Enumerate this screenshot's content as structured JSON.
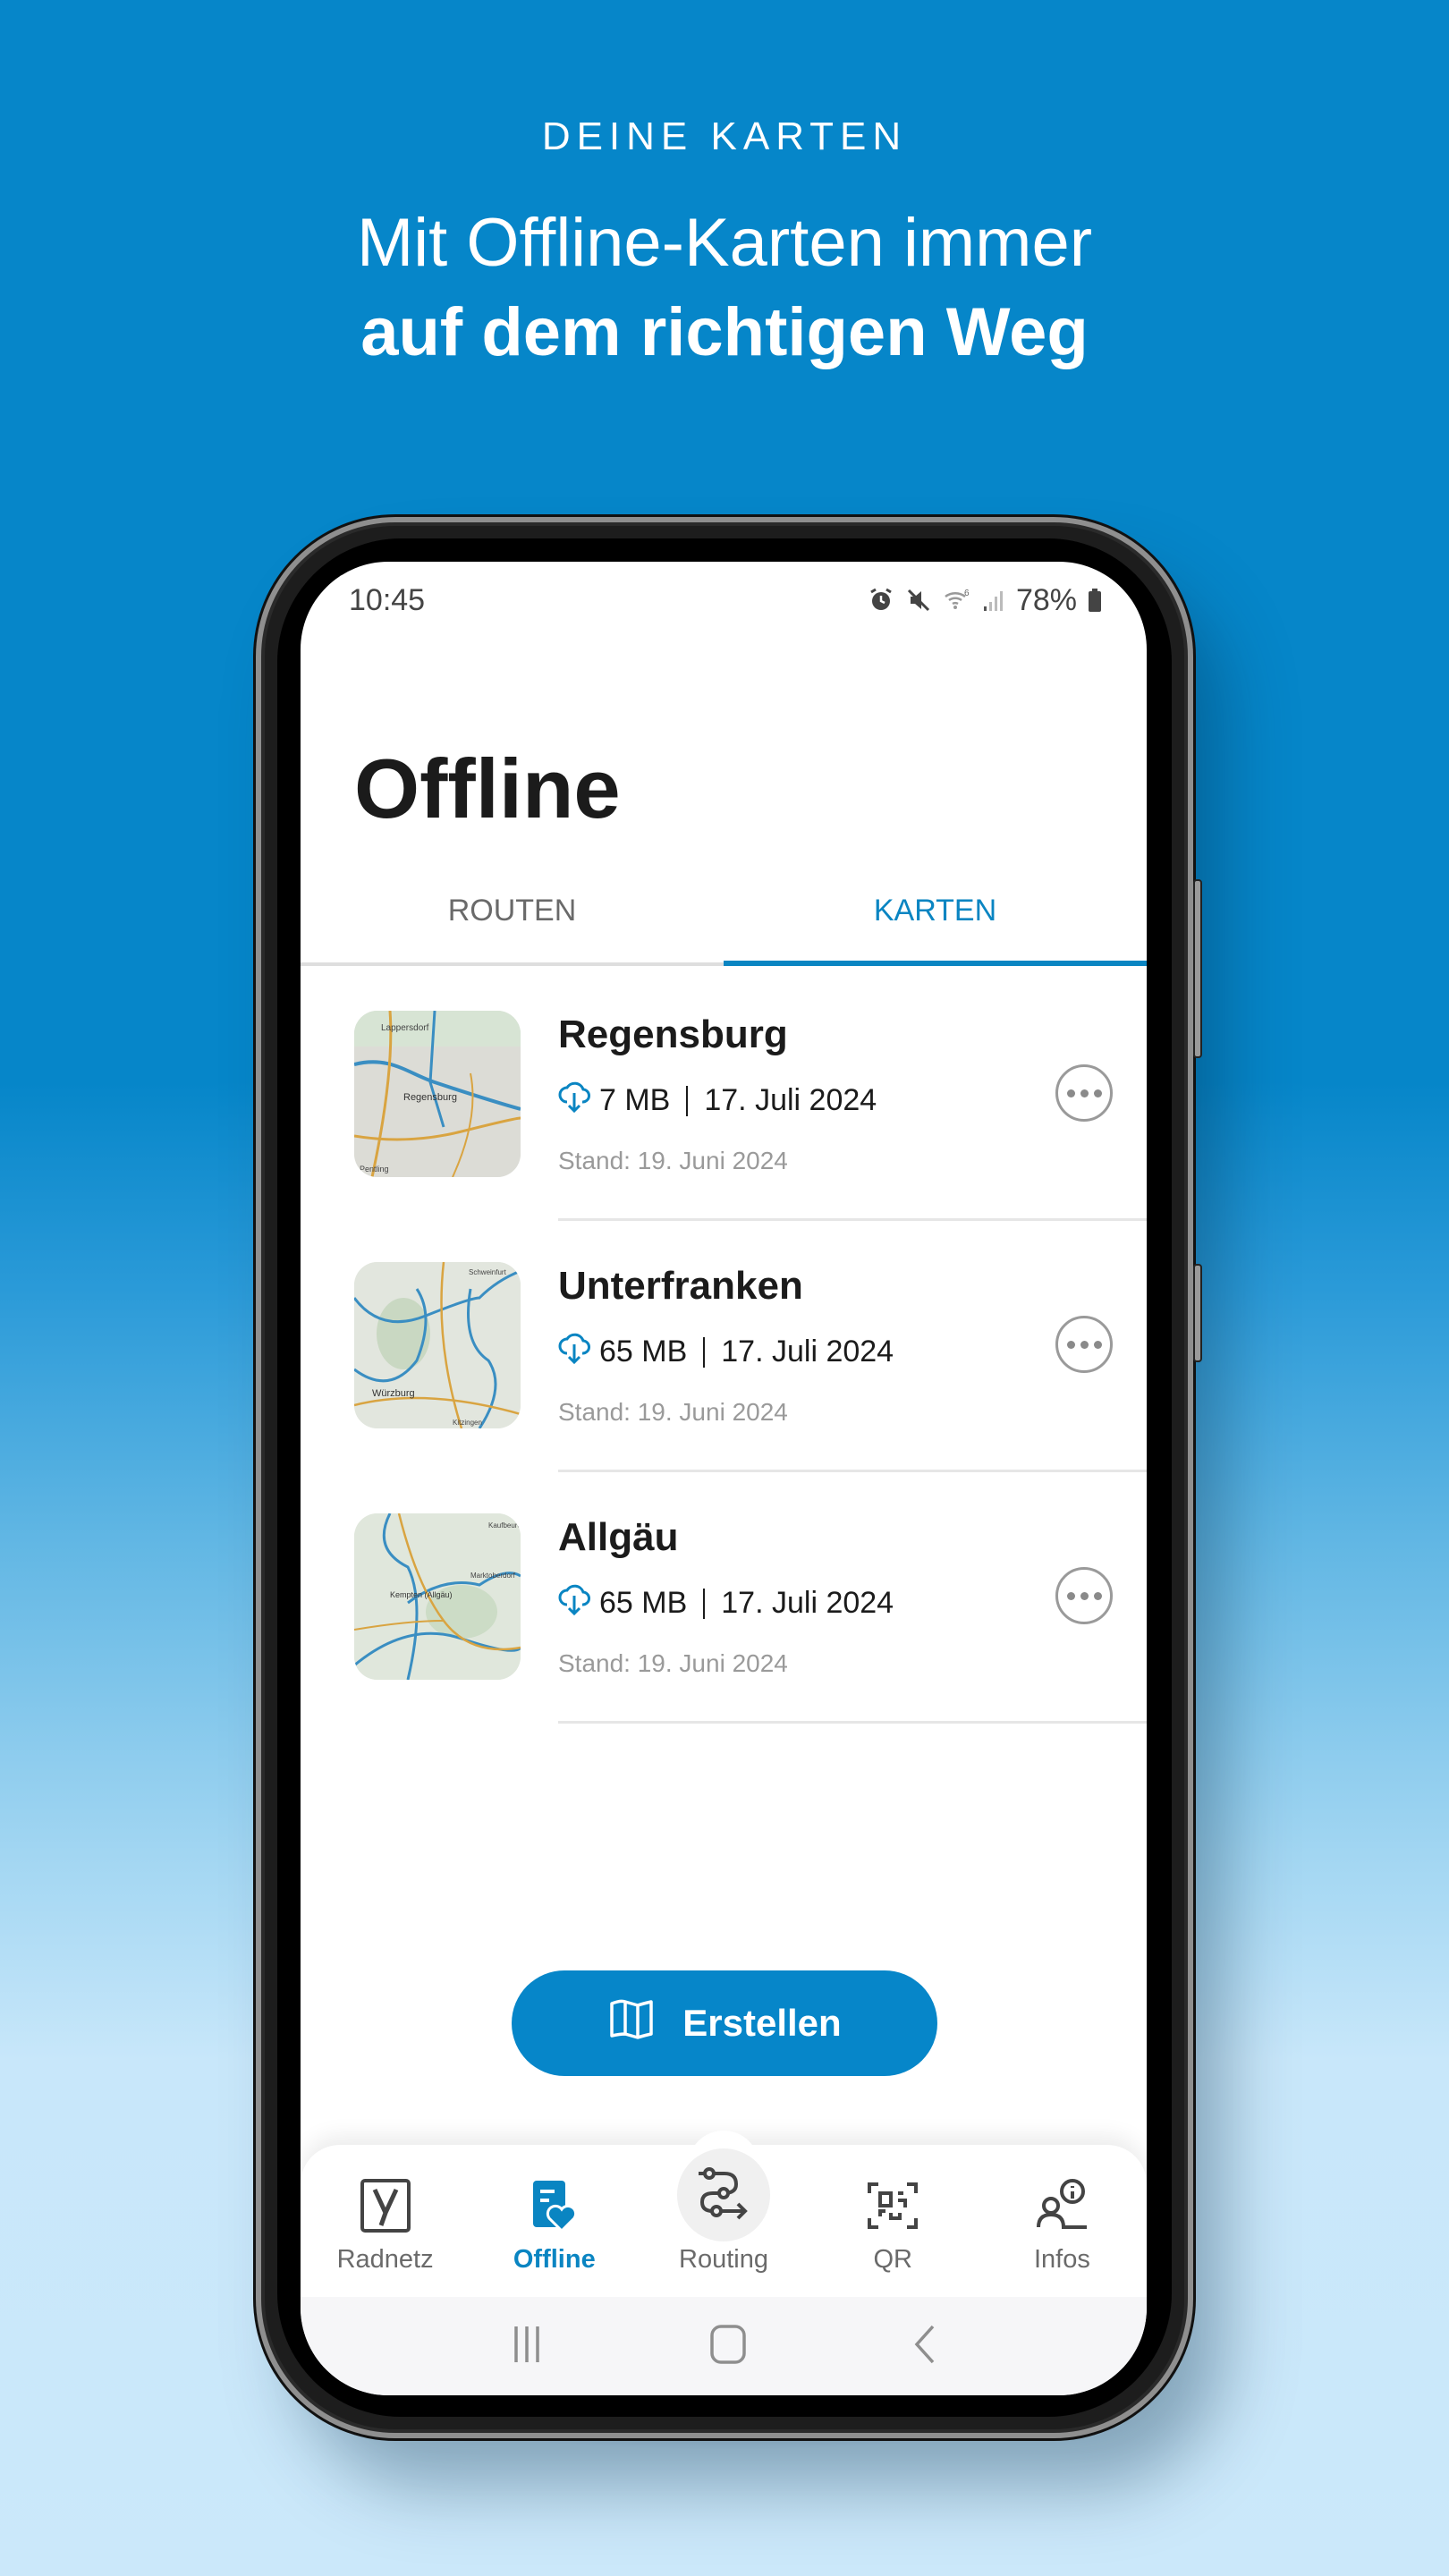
{
  "promo": {
    "eyebrow": "DEINE KARTEN",
    "headline_line1": "Mit Offline-Karten immer",
    "headline_line2": "auf dem richtigen Weg"
  },
  "status_bar": {
    "time": "10:45",
    "battery": "78%",
    "icons": [
      "alarm-icon",
      "mute-icon",
      "wifi-icon",
      "signal-icon",
      "battery-icon"
    ]
  },
  "page": {
    "title": "Offline"
  },
  "tabs": [
    {
      "label": "ROUTEN",
      "active": false
    },
    {
      "label": "KARTEN",
      "active": true
    }
  ],
  "maps": [
    {
      "name": "Regensburg",
      "size": "7 MB",
      "date": "17. Juli 2024",
      "stand": "Stand: 19. Juni 2024",
      "thumb_labels": [
        "Lappersdorf",
        "Regensburg",
        "Pentling"
      ]
    },
    {
      "name": "Unterfranken",
      "size": "65 MB",
      "date": "17. Juli 2024",
      "stand": "Stand: 19. Juni 2024",
      "thumb_labels": [
        "Schweinfurt",
        "Würzburg",
        "Kitzingen"
      ]
    },
    {
      "name": "Allgäu",
      "size": "65 MB",
      "date": "17. Juli 2024",
      "stand": "Stand: 19. Juni 2024",
      "thumb_labels": [
        "Kaufbeuren",
        "Marktoberdorf",
        "Kempten (Allgäu)"
      ]
    }
  ],
  "create_button": {
    "label": "Erstellen",
    "icon": "map-icon"
  },
  "bottom_nav": [
    {
      "label": "Radnetz",
      "icon": "radnetz-logo-icon",
      "active": false
    },
    {
      "label": "Offline",
      "icon": "offline-favorite-icon",
      "active": true
    },
    {
      "label": "Routing",
      "icon": "routing-icon",
      "active": false
    },
    {
      "label": "QR",
      "icon": "qr-scan-icon",
      "active": false
    },
    {
      "label": "Infos",
      "icon": "info-user-icon",
      "active": false
    }
  ],
  "colors": {
    "accent": "#0a85c2",
    "button": "#0686c9",
    "background_top": "#0686c9",
    "background_bottom": "#cbe8fa"
  }
}
